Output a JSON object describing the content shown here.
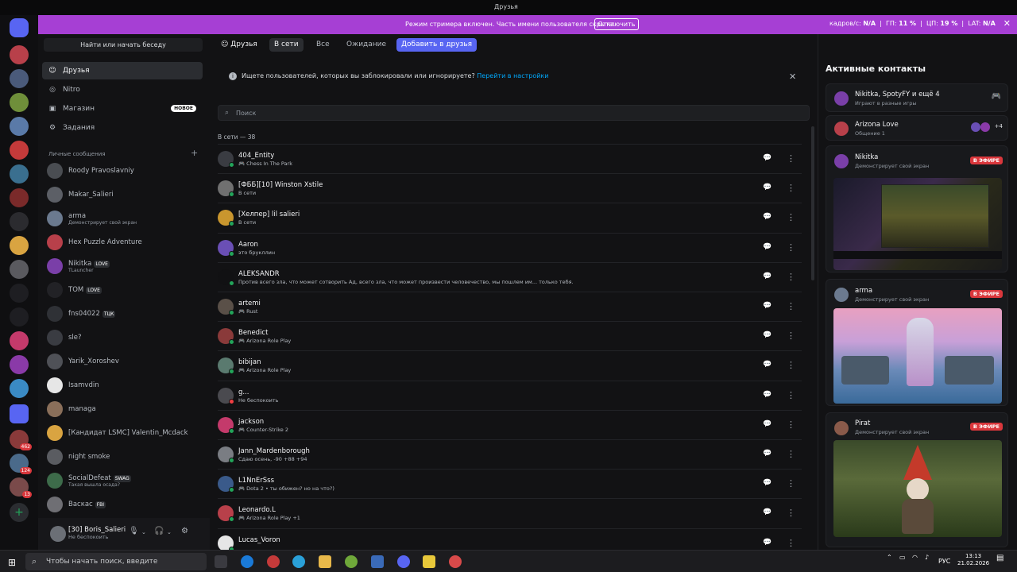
{
  "window": {
    "title": "Друзья"
  },
  "streamer_bar": {
    "message": "Режим стримера включен. Часть имени пользователя скрыта.",
    "disable_label": "Отключить",
    "fps_label": "кадров/с:",
    "fps_value": "N/A",
    "gpu_label": "ГП:",
    "gpu_value": "11 %",
    "cpu_label": "ЦП:",
    "cpu_value": "19 %",
    "lat_label": "LAT:",
    "lat_value": "N/A"
  },
  "dm_column": {
    "find_label": "Найти или начать беседу",
    "nav": [
      {
        "label": "Друзья",
        "icon": "friends-icon"
      },
      {
        "label": "Nitro",
        "icon": "nitro-icon"
      },
      {
        "label": "Магазин",
        "icon": "shop-icon",
        "badge": "НОВОЕ"
      },
      {
        "label": "Задания",
        "icon": "quests-icon"
      }
    ],
    "dm_header": "Личные сообщения",
    "dms": [
      {
        "name": "Roody Pravoslavniy",
        "sub": "",
        "color": "#4a4d52"
      },
      {
        "name": "Makar_Salieri",
        "sub": "",
        "color": "#5c5f66"
      },
      {
        "name": "arma",
        "sub": "Демонстрирует свой экран",
        "color": "#6b7a8f"
      },
      {
        "name": "Hex Puzzle Adventure",
        "sub": "",
        "color": "#b8404a"
      },
      {
        "name": "Nikitka",
        "tag": "LOVE",
        "sub": "TLauncher",
        "color": "#7a3fa8"
      },
      {
        "name": "TOM",
        "tag": "LOVE",
        "sub": "",
        "color": "#222226"
      },
      {
        "name": "fns04022",
        "tag": "ТЦК",
        "sub": "",
        "color": "#2f3136"
      },
      {
        "name": "sle?",
        "sub": "",
        "color": "#3a3c42"
      },
      {
        "name": "Yarik_Xoroshev",
        "sub": "",
        "color": "#4f5157"
      },
      {
        "name": "Isamvdin",
        "sub": "",
        "color": "#e6e6e6"
      },
      {
        "name": "managa",
        "sub": "",
        "color": "#8a6f5a"
      },
      {
        "name": "[Кандидат LSMC] Valentin_Mcdack",
        "sub": "",
        "color": "#d9a441"
      },
      {
        "name": "night smoke",
        "sub": "",
        "color": "#5a5c61"
      },
      {
        "name": "SocialDefeat",
        "tag": "SWAG",
        "sub": "Такая вышла осада?",
        "color": "#3d6b4a"
      },
      {
        "name": "Васкас",
        "tag": "FBI",
        "sub": "",
        "color": "#6f6f74"
      }
    ]
  },
  "user_panel": {
    "name": "[30] Boris_Salieri",
    "status": "Не беспокоить"
  },
  "toolbar": {
    "title": "Друзья",
    "tabs": [
      "В сети",
      "Все",
      "Ожидание"
    ],
    "add_label": "Добавить в друзья"
  },
  "notice": {
    "text": "Ищете пользователей, которых вы заблокировали или игнорируете?",
    "link": "Перейти в настройки"
  },
  "search": {
    "placeholder": "Поиск"
  },
  "online_count": "В сети — 38",
  "friends": [
    {
      "name": "404_Entity",
      "sub": "Chess In The Park",
      "game": true,
      "status": "#23a55a",
      "color": "#3a3c42"
    },
    {
      "name": "[ФББ][10] Winston Xstile",
      "sub": "В сети",
      "game": false,
      "status": "#23a55a",
      "color": "#707070"
    },
    {
      "name": "[Хелпер] lil salieri",
      "sub": "В сети",
      "game": false,
      "status": "#23a55a",
      "color": "#c9962e"
    },
    {
      "name": "Aaron",
      "sub": "это брукллин",
      "game": false,
      "status": "#23a55a",
      "color": "#6a4fb5"
    },
    {
      "name": "ALEKSANDR",
      "sub": "Против всего зла, что может сотворить Ад, всего зла, что может произвести человечество, мы пошлем им... только тебя.",
      "game": false,
      "status": "#23a55a",
      "color": "#111113"
    },
    {
      "name": "artemi",
      "sub": "Rust",
      "game": true,
      "status": "#23a55a",
      "color": "#5a5048"
    },
    {
      "name": "Benedict",
      "sub": "Arizona Role Play",
      "game": true,
      "status": "#23a55a",
      "color": "#8a3a3a"
    },
    {
      "name": "bibijan",
      "sub": "Arizona Role Play",
      "game": true,
      "status": "#23a55a",
      "color": "#5a7a6f"
    },
    {
      "name": "g...",
      "sub": "Не беспокоить",
      "game": false,
      "status": "#f23f43",
      "color": "#4a4a4f"
    },
    {
      "name": "jackson",
      "sub": "Counter-Strike 2",
      "game": true,
      "status": "#23a55a",
      "color": "#c43a6b"
    },
    {
      "name": "Jann_Mardenborough",
      "sub": "Сдаю осень, -90 +88 +94",
      "game": false,
      "status": "#23a55a",
      "color": "#7a7d83"
    },
    {
      "name": "L1NnErSss",
      "sub": "Dota 2 • ты обижен? но на что?)",
      "game": true,
      "status": "#23a55a",
      "color": "#3a5a8a"
    },
    {
      "name": "Leonardo.L",
      "sub": "Arizona Role Play +1",
      "game": true,
      "status": "#23a55a",
      "color": "#b8404a"
    },
    {
      "name": "Lucas_Voron",
      "sub": "",
      "game": false,
      "status": "#23a55a",
      "color": "#e6e6e6"
    }
  ],
  "active_contacts": {
    "title": "Активные контакты",
    "group": {
      "name": "Nikitka, SpotyFY и ещё 4",
      "sub": "Играют в разные игры"
    },
    "voice": {
      "name": "Arizona Love",
      "sub": "Общение 1",
      "extra": "+4"
    },
    "streams": [
      {
        "name": "Nikitka",
        "sub": "Демонстрирует свой экран",
        "live": "В ЭФИРЕ"
      },
      {
        "name": "arma",
        "sub": "Демонстрирует свой экран",
        "live": "В ЭФИРЕ"
      },
      {
        "name": "Pirat",
        "sub": "Демонстрирует свой экран",
        "live": "В ЭФИРЕ"
      }
    ]
  },
  "taskbar": {
    "search_placeholder": "Чтобы начать поиск, введите",
    "lang": "РУС",
    "time": "13:13",
    "date": "21.02.2026"
  }
}
